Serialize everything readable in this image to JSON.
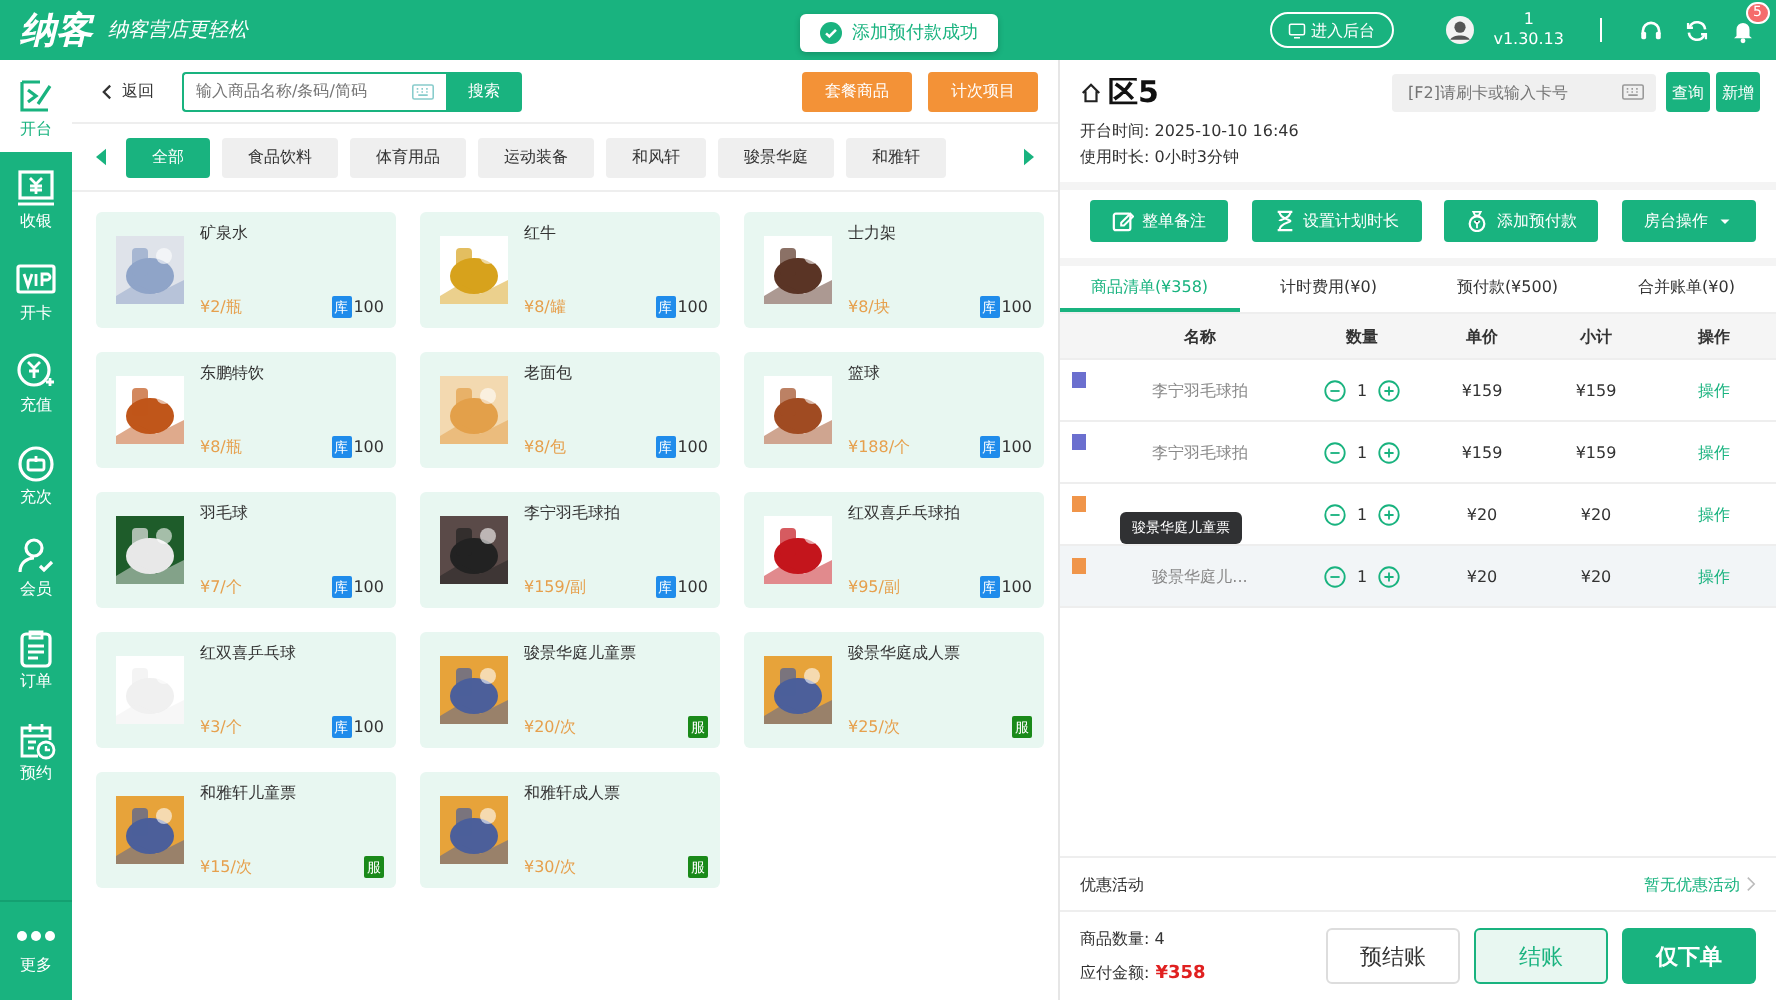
{
  "topbar": {
    "logo": "纳客",
    "slogan": "纳客营店更轻松",
    "toast": "添加预付款成功",
    "backend_button": "进入后台",
    "user": "1",
    "version": "v1.30.13",
    "notifications": "5"
  },
  "sidebar": {
    "items": [
      {
        "label": "开台",
        "selected": true
      },
      {
        "label": "收银",
        "selected": false
      },
      {
        "label": "开卡",
        "selected": false
      },
      {
        "label": "充值",
        "selected": false
      },
      {
        "label": "充次",
        "selected": false
      },
      {
        "label": "会员",
        "selected": false
      },
      {
        "label": "订单",
        "selected": false
      },
      {
        "label": "预约",
        "selected": false
      }
    ],
    "more": "更多"
  },
  "toolbar": {
    "back": "返回",
    "search": {
      "placeholder": "输入商品名称/条码/简码"
    },
    "search_button": "搜索",
    "buttons": [
      "套餐商品",
      "计次项目"
    ]
  },
  "categories": [
    {
      "label": "全部",
      "selected": true
    },
    {
      "label": "食品饮料",
      "selected": false
    },
    {
      "label": "体育用品",
      "selected": false
    },
    {
      "label": "运动装备",
      "selected": false
    },
    {
      "label": "和风轩",
      "selected": false
    },
    {
      "label": "骏景华庭",
      "selected": false
    },
    {
      "label": "和雅轩",
      "selected": false
    }
  ],
  "products": [
    {
      "name": "矿泉水",
      "price": "¥2/瓶",
      "kind": "stock",
      "stock": "库",
      "count": "100"
    },
    {
      "name": "红牛",
      "price": "¥8/罐",
      "kind": "stock",
      "stock": "库",
      "count": "100"
    },
    {
      "name": "士力架",
      "price": "¥8/块",
      "kind": "stock",
      "stock": "库",
      "count": "100"
    },
    {
      "name": "东鹏特饮",
      "price": "¥8/瓶",
      "kind": "stock",
      "stock": "库",
      "count": "100"
    },
    {
      "name": "老面包",
      "price": "¥8/包",
      "kind": "stock",
      "stock": "库",
      "count": "100"
    },
    {
      "name": "篮球",
      "price": "¥188/个",
      "kind": "stock",
      "stock": "库",
      "count": "100"
    },
    {
      "name": "羽毛球",
      "price": "¥7/个",
      "kind": "stock",
      "stock": "库",
      "count": "100"
    },
    {
      "name": "李宁羽毛球拍",
      "price": "¥159/副",
      "kind": "stock",
      "stock": "库",
      "count": "100"
    },
    {
      "name": "红双喜乒乓球拍",
      "price": "¥95/副",
      "kind": "stock",
      "stock": "库",
      "count": "100"
    },
    {
      "name": "红双喜乒乓球",
      "price": "¥3/个",
      "kind": "stock",
      "stock": "库",
      "count": "100"
    },
    {
      "name": "骏景华庭儿童票",
      "price": "¥20/次",
      "kind": "service",
      "stock": "服"
    },
    {
      "name": "骏景华庭成人票",
      "price": "¥25/次",
      "kind": "service",
      "stock": "服"
    },
    {
      "name": "和雅轩儿童票",
      "price": "¥15/次",
      "kind": "service",
      "stock": "服"
    },
    {
      "name": "和雅轩成人票",
      "price": "¥30/次",
      "kind": "service",
      "stock": "服"
    }
  ],
  "room": {
    "title": "区5",
    "card_search": {
      "placeholder": "[F2]请刷卡或输入卡号"
    },
    "query_button": "查询",
    "new_button": "新增",
    "open_time": "开台时间: 2025-10-10 16:46",
    "duration": "使用时长: 0小时3分钟"
  },
  "actions": [
    {
      "label": "整单备注",
      "kind": "button"
    },
    {
      "label": "设置计划时长",
      "kind": "button"
    },
    {
      "label": "添加预付款",
      "kind": "button"
    },
    {
      "label": "房台操作",
      "kind": "dropdown"
    }
  ],
  "tabs": [
    {
      "label": "商品清单(¥358)",
      "selected": true
    },
    {
      "label": "计时费用(¥0)",
      "selected": false
    },
    {
      "label": "预付款(¥500)",
      "selected": false
    },
    {
      "label": "合并账单(¥0)",
      "selected": false
    }
  ],
  "table": {
    "columns": [
      "名称",
      "数量",
      "单价",
      "小计",
      "操作"
    ],
    "rows": [
      {
        "color": "#6b6fcf",
        "name": "李宁羽毛球拍",
        "qty": "1",
        "price": "¥159",
        "subtotal": "¥159",
        "action": "操作",
        "hover": false
      },
      {
        "color": "#6b6fcf",
        "name": "李宁羽毛球拍",
        "qty": "1",
        "price": "¥159",
        "subtotal": "¥159",
        "action": "操作",
        "hover": false
      },
      {
        "color": "#f0954a",
        "qty": "1",
        "price": "¥20",
        "subtotal": "¥20",
        "action": "操作",
        "hover": false
      },
      {
        "color": "#f0954a",
        "name": "骏景华庭儿...",
        "qty": "1",
        "price": "¥20",
        "subtotal": "¥20",
        "action": "操作",
        "hover": true,
        "tooltip": "骏景华庭儿童票"
      }
    ]
  },
  "promo": {
    "label": "优惠活动",
    "value": "暂无优惠活动"
  },
  "summary": {
    "count": "商品数量: 4",
    "amount_label": "应付金额:",
    "amount": "¥358"
  },
  "footer_buttons": [
    {
      "label": "预结账",
      "kind": "plain"
    },
    {
      "label": "结账",
      "kind": "light"
    },
    {
      "label": "仅下单",
      "kind": "primary"
    }
  ]
}
